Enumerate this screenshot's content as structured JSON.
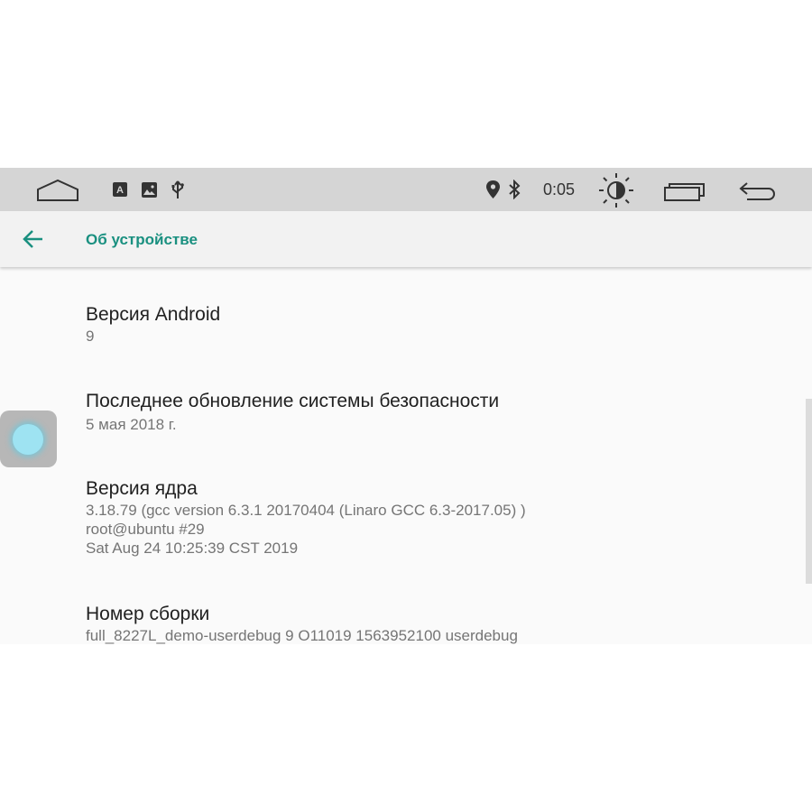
{
  "status_bar": {
    "time": "0:05",
    "icons_left": [
      "home-icon",
      "keyboard-a-icon",
      "image-icon",
      "usb-icon"
    ],
    "icons_right": [
      "location-icon",
      "bluetooth-icon",
      "brightness-icon",
      "recents-icon",
      "back-arrow-icon"
    ]
  },
  "app_bar": {
    "back_icon": "arrow-back-icon",
    "title": "Об устройстве"
  },
  "items": [
    {
      "title": "Версия Android",
      "summary": "9"
    },
    {
      "title": "Последнее обновление системы безопасности",
      "summary": "5 мая 2018 г."
    },
    {
      "title": "Версия ядра",
      "summary": "3.18.79 (gcc version 6.3.1 20170404 (Linaro GCC 6.3-2017.05) )\nroot@ubuntu #29\nSat Aug 24 10:25:39 CST 2019"
    },
    {
      "title": "Номер сборки",
      "summary": "full_8227L_demo-userdebug 9 O11019 1563952100 userdebug"
    }
  ],
  "colors": {
    "accent": "#1a9080",
    "status_bar_bg": "#d5d5d5",
    "background": "#fafafa"
  }
}
